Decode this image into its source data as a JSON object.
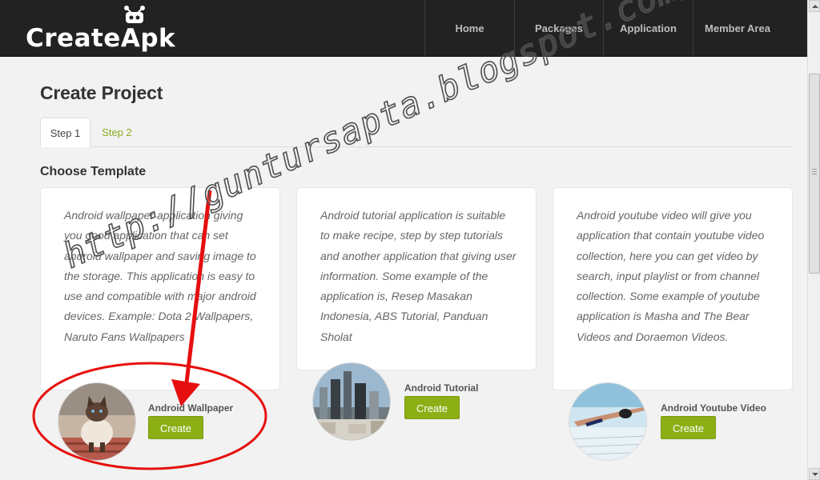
{
  "app": {
    "logo_text": "CreateApk"
  },
  "nav": {
    "items": [
      {
        "label": "Home"
      },
      {
        "label": "Packages"
      },
      {
        "label": "Application"
      },
      {
        "label": "Member Area"
      }
    ]
  },
  "page": {
    "title": "Create Project",
    "tabs": [
      {
        "label": "Step 1",
        "active": true
      },
      {
        "label": "Step 2",
        "active": false
      }
    ],
    "section_title": "Choose Template"
  },
  "templates": [
    {
      "description": "Android wallpaper application giving you good application that can set android wallpaper and saving image to the storage. This application is easy to use and compatible with major android devices. Example: Dota 2 Wallpapers, Naruto Fans Wallpapers",
      "name": "Android Wallpaper",
      "button_label": "Create",
      "thumbnail": "cat-photo"
    },
    {
      "description": "Android tutorial application is suitable to make recipe, step by step tutorials and another application that giving user information. Some example of the application is, Resep Masakan Indonesia, ABS Tutorial, Panduan Sholat",
      "name": "Android Tutorial",
      "button_label": "Create",
      "thumbnail": "city-photo"
    },
    {
      "description": "Android youtube video will give you application that contain youtube video collection, here you can get video by search, input playlist or from channel collection. Some example of youtube application is Masha and The Bear Videos and Doraemon Videos.",
      "name": "Android Youtube Video",
      "button_label": "Create",
      "thumbnail": "swimmer-photo"
    }
  ],
  "watermark": "http://guntursapta.blogspot.com/",
  "colors": {
    "navbar": "#222222",
    "accent_green": "#8caf16",
    "tab_link": "#8aaa1f",
    "annotation_red": "#e60f0f",
    "background": "#f2f2f2"
  }
}
